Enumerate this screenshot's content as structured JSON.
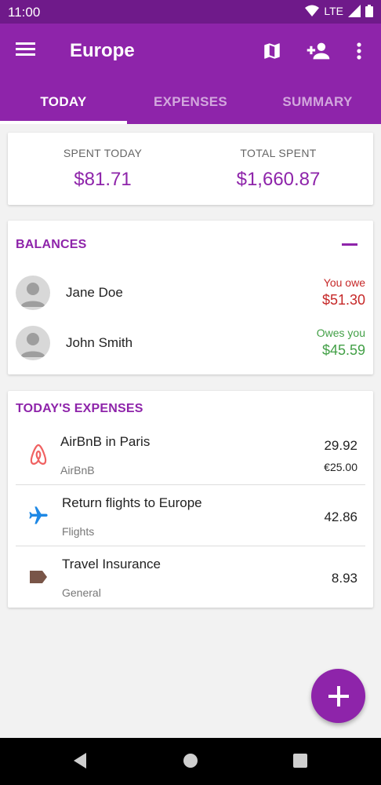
{
  "status_bar": {
    "time": "11:00",
    "network": "LTE"
  },
  "app_bar": {
    "title": "Europe",
    "icons": [
      "menu-icon",
      "map-icon",
      "add-person-icon",
      "more-vert-icon"
    ]
  },
  "tabs": [
    {
      "label": "TODAY",
      "active": true
    },
    {
      "label": "EXPENSES",
      "active": false
    },
    {
      "label": "SUMMARY",
      "active": false
    }
  ],
  "summary": {
    "spent_today_label": "SPENT TODAY",
    "spent_today_value": "$81.71",
    "total_spent_label": "TOTAL SPENT",
    "total_spent_value": "$1,660.87"
  },
  "balances": {
    "title": "BALANCES",
    "rows": [
      {
        "name": "Jane Doe",
        "status": "You owe",
        "amount": "$51.30"
      },
      {
        "name": "John Smith",
        "status": "Owes you",
        "amount": "$45.59"
      }
    ]
  },
  "todays_expenses": {
    "title": "TODAY'S EXPENSES",
    "rows": [
      {
        "title": "AirBnB in Paris",
        "category": "AirBnB",
        "amount": "29.92",
        "original": "€25.00",
        "icon": "airbnb-icon"
      },
      {
        "title": "Return flights to Europe",
        "category": "Flights",
        "amount": "42.86",
        "icon": "airplane-icon"
      },
      {
        "title": "Travel Insurance",
        "category": "General",
        "amount": "8.93",
        "icon": "tag-icon"
      }
    ]
  },
  "fab": {
    "icon": "add-icon"
  },
  "colors": {
    "primary": "#8e24aa",
    "status_bar": "#6f1a8a",
    "owe": "#c62828",
    "owed": "#43a047"
  }
}
